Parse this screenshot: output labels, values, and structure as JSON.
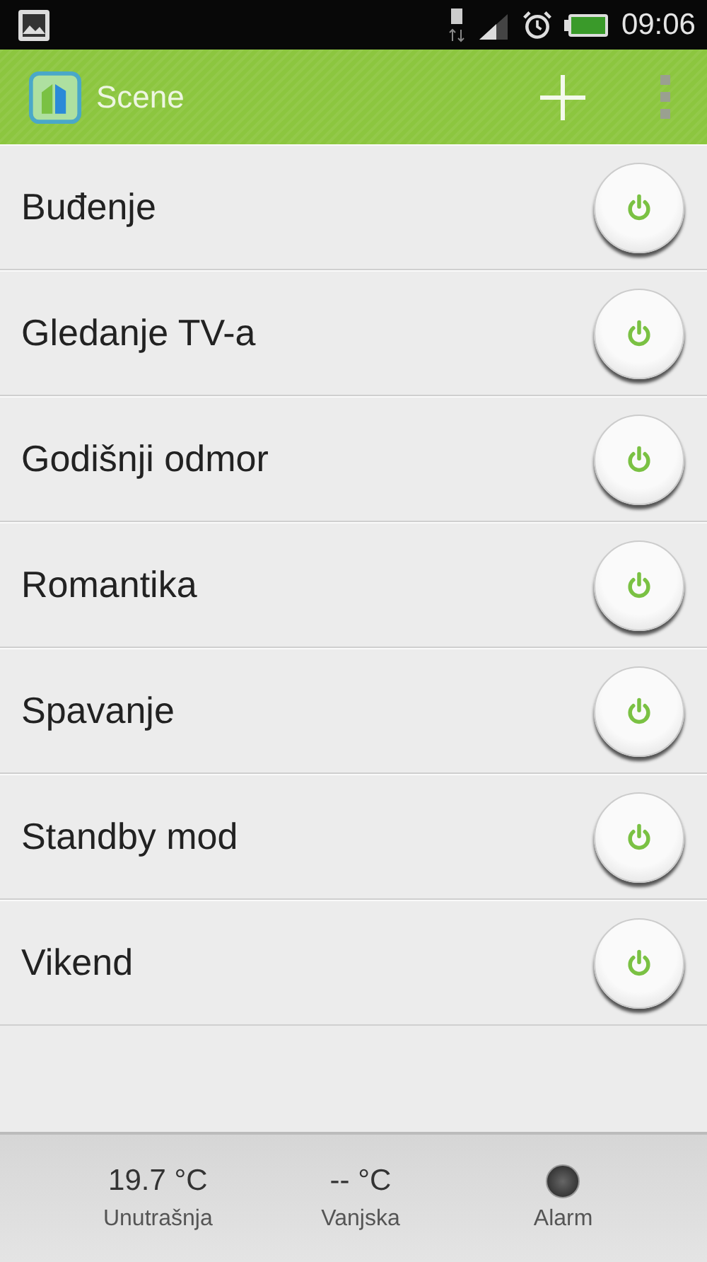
{
  "status_bar": {
    "time": "09:06"
  },
  "app_bar": {
    "title": "Scene"
  },
  "scenes": [
    {
      "name": "Buđenje"
    },
    {
      "name": "Gledanje TV-a"
    },
    {
      "name": "Godišnji odmor"
    },
    {
      "name": "Romantika"
    },
    {
      "name": "Spavanje"
    },
    {
      "name": "Standby mod"
    },
    {
      "name": "Vikend"
    }
  ],
  "footer": [
    {
      "kind": "reading",
      "value": "19.7 °C",
      "label": "Unutrašnja"
    },
    {
      "kind": "reading",
      "value": "-- °C",
      "label": "Vanjska"
    },
    {
      "kind": "indicator",
      "on": false,
      "label": "Alarm"
    }
  ]
}
